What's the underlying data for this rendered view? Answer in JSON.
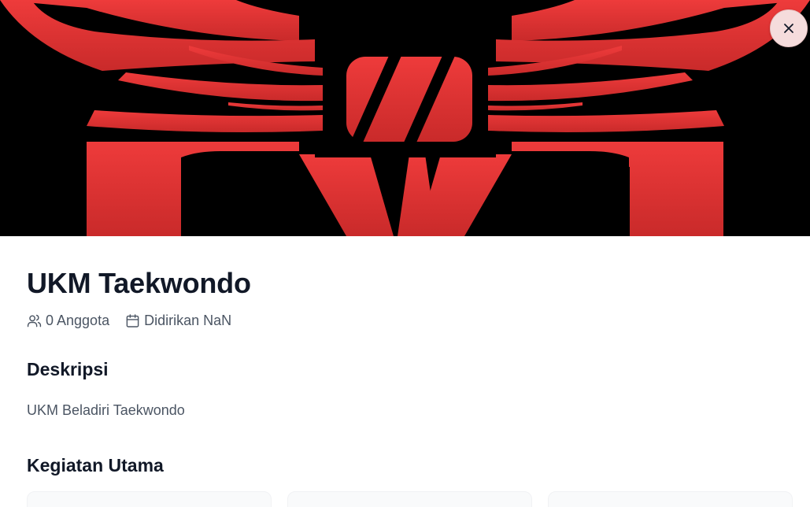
{
  "banner": {
    "logo_colors": {
      "primary": "#e03535",
      "dark": "#000000"
    }
  },
  "close_button": {
    "icon": "close-icon"
  },
  "club": {
    "name": "UKM Taekwondo",
    "members_icon": "users-icon",
    "members_label": "0 Anggota",
    "founded_icon": "calendar-icon",
    "founded_label": "Didirikan NaN"
  },
  "description": {
    "title": "Deskripsi",
    "text": "UKM Beladiri Taekwondo"
  },
  "activities": {
    "title": "Kegiatan Utama",
    "cards": [
      {},
      {},
      {}
    ]
  },
  "colors": {
    "heading": "#111827",
    "muted": "#4b5563",
    "card_bg": "#f9fafb"
  }
}
